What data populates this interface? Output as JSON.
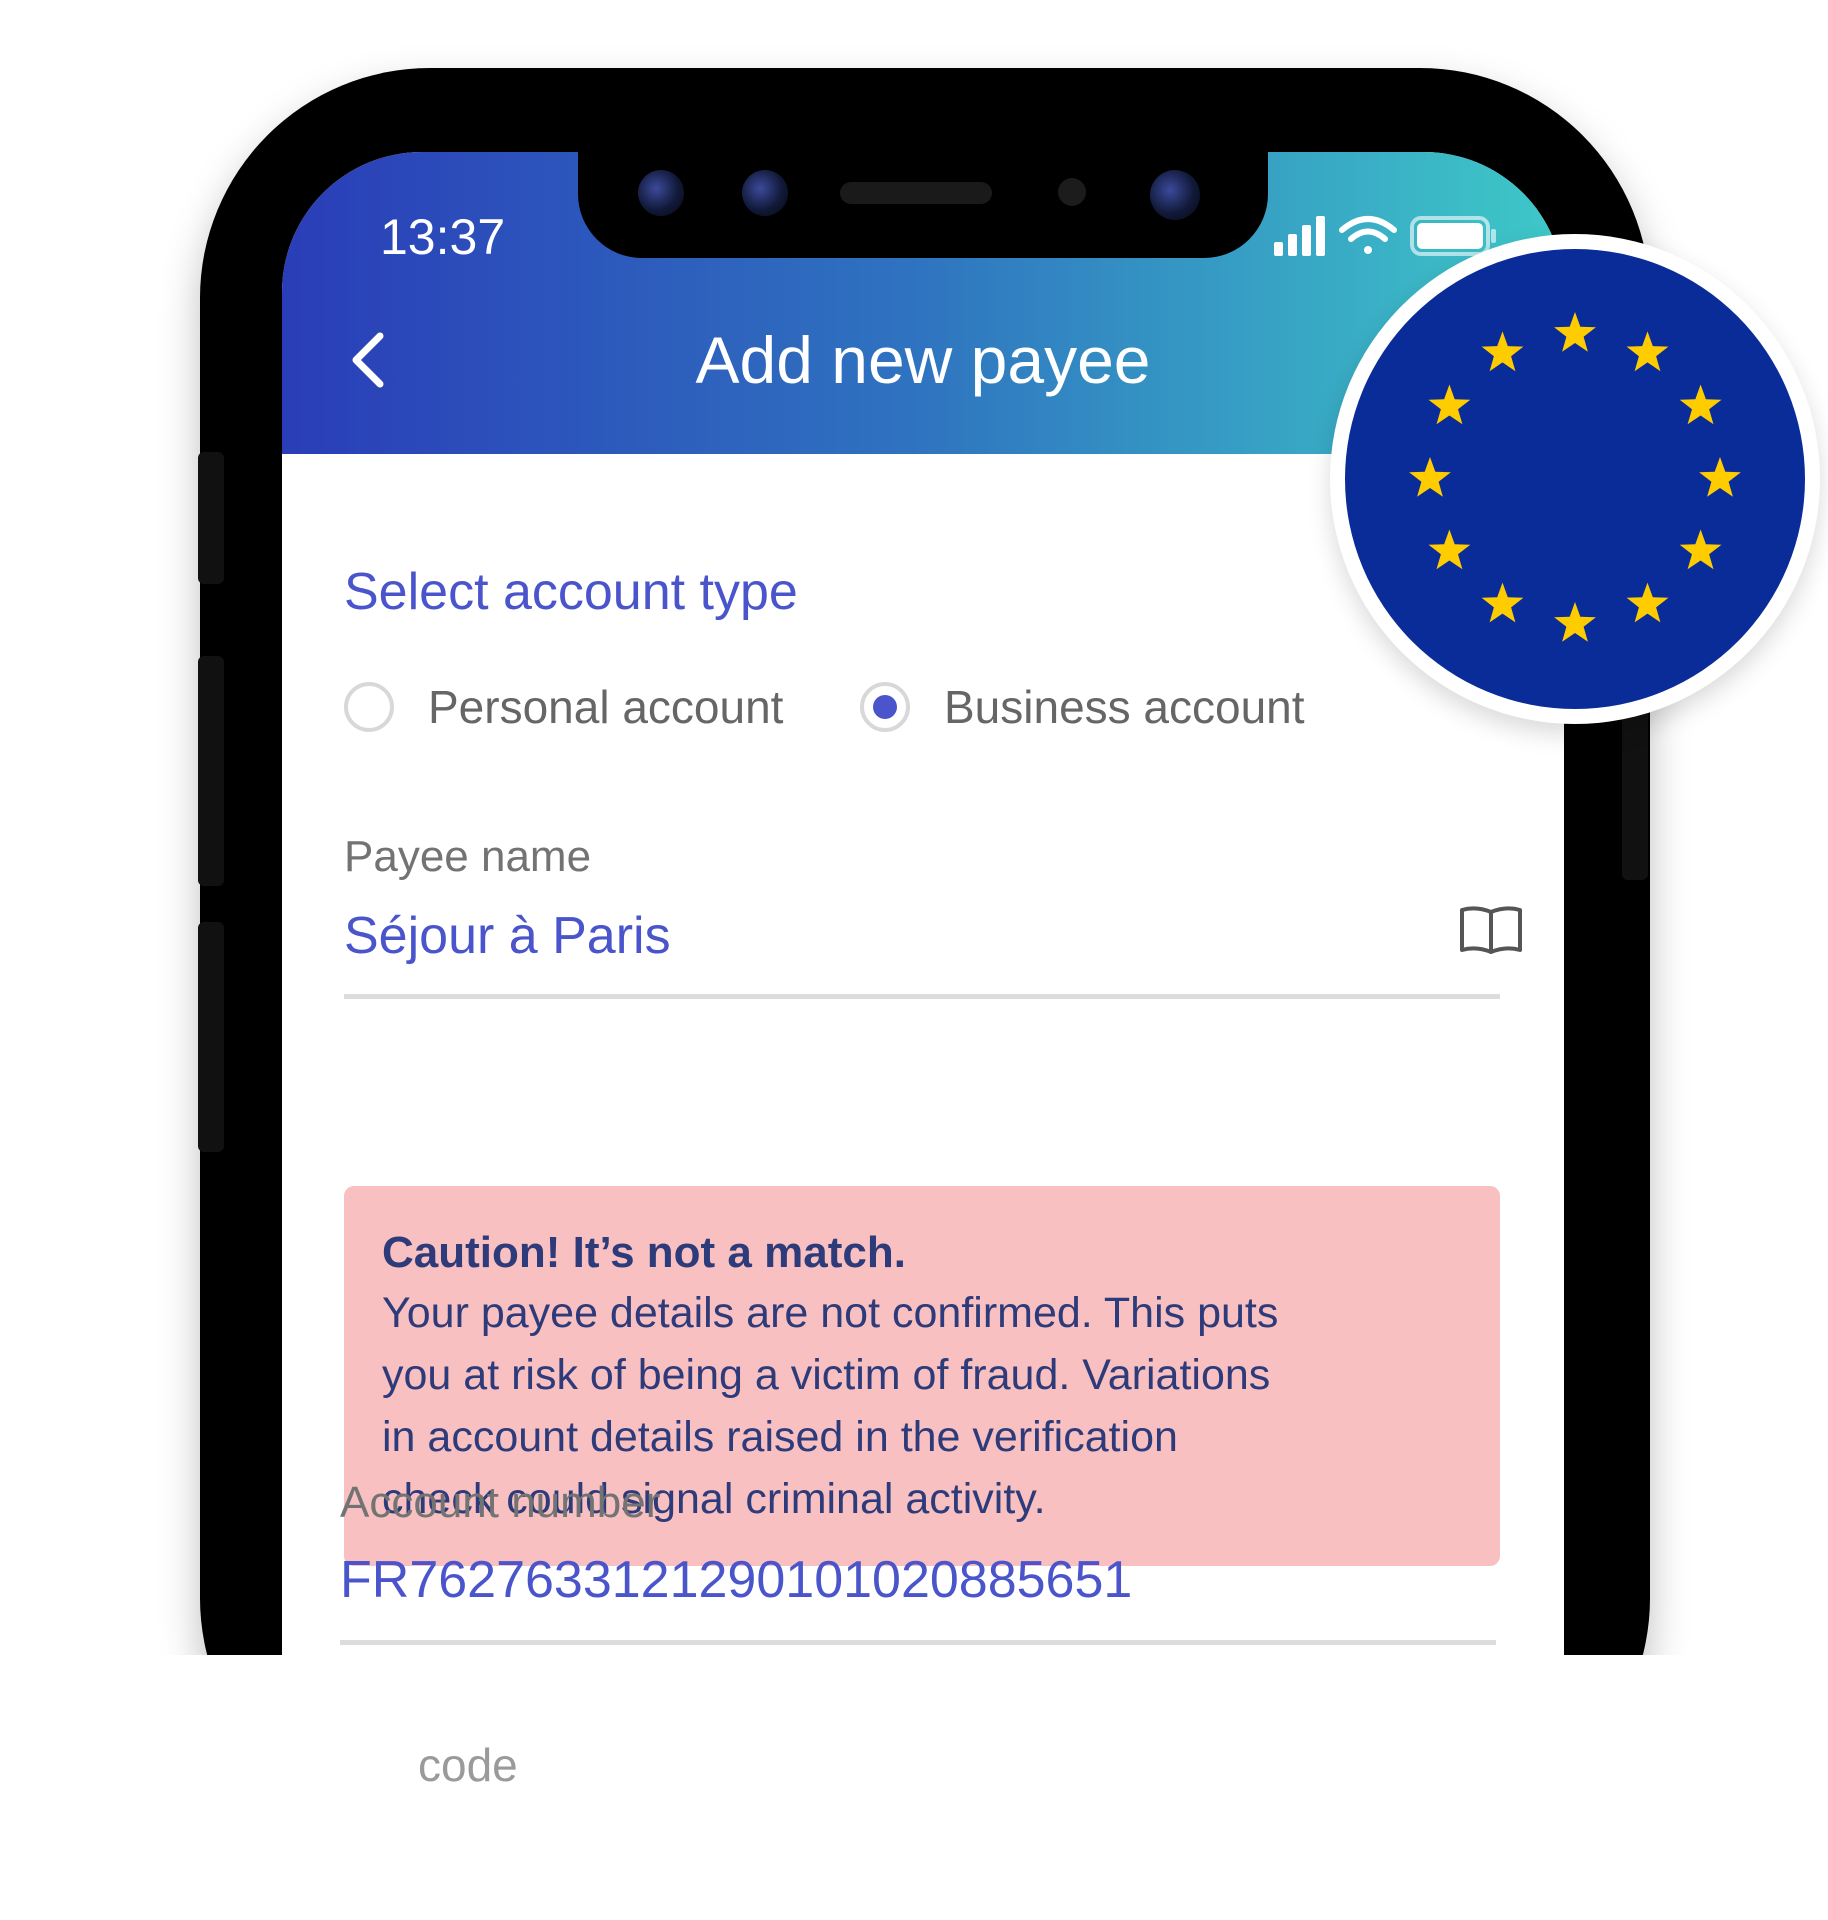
{
  "status_bar": {
    "time": "13:37"
  },
  "header": {
    "title": "Add new payee"
  },
  "account_type": {
    "section_title": "Select account type",
    "options": [
      {
        "label": "Personal account",
        "selected": false
      },
      {
        "label": "Business account",
        "selected": true
      }
    ]
  },
  "payee_name": {
    "label": "Payee name",
    "value": "Séjour à Paris"
  },
  "alert": {
    "title": "Caution! It’s not a match.",
    "lines": [
      "Your payee details are not confirmed. This puts",
      "you at risk of being a victim of fraud. Variations",
      "in account details raised in the verification",
      "check could signal criminal activity."
    ]
  },
  "account_number": {
    "label": "Account number",
    "value": "FR7627633121290101020885651"
  },
  "partial_label": "code",
  "colors": {
    "accent": "#4a55cc",
    "alert_background": "#f8c0c0",
    "header_gradient_start": "#2a3db8",
    "header_gradient_end": "#3ec9c8",
    "eu_flag_blue": "#0a2c99",
    "eu_star_yellow": "#ffcc00"
  },
  "icons": [
    "back-chevron-icon",
    "signal-icon",
    "wifi-icon",
    "battery-icon",
    "book-icon",
    "eu-flag-icon"
  ]
}
